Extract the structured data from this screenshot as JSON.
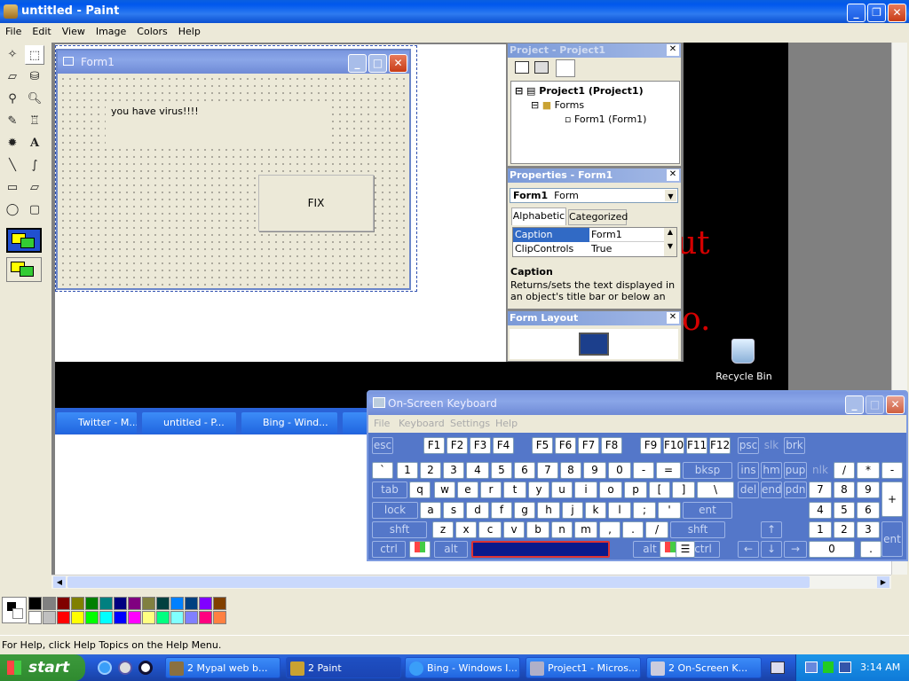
{
  "paint": {
    "title": "untitled - Paint",
    "menu": [
      "File",
      "Edit",
      "View",
      "Image",
      "Colors",
      "Help"
    ],
    "status": "For Help, click Help Topics on the Help Menu."
  },
  "form1": {
    "title": "Form1",
    "label": "you have virus!!!!",
    "button": "FIX"
  },
  "project": {
    "panel_title": "Project - Project1",
    "root": "Project1 (Project1)",
    "folder": "Forms",
    "form": "Form1 (Form1)"
  },
  "properties": {
    "panel_title": "Properties - Form1",
    "object_name": "Form1",
    "object_type": "Form",
    "tabs": [
      "Alphabetic",
      "Categorized"
    ],
    "rows": [
      {
        "name": "Caption",
        "value": "Form1"
      },
      {
        "name": "ClipControls",
        "value": "True"
      }
    ],
    "desc_title": "Caption",
    "desc_text": "Returns/sets the text displayed in an object's title bar or below an object's"
  },
  "form_layout": {
    "panel_title": "Form Layout"
  },
  "desktop": {
    "red_text_1": "ut",
    "red_text_2": "o.",
    "recycle_bin": "Recycle Bin"
  },
  "hidden_tasks": [
    "Twitter - M...",
    "untitled - P...",
    "Bing - Wind..."
  ],
  "osk": {
    "title": "On-Screen Keyboard",
    "menu": [
      "File",
      "Keyboard",
      "Settings",
      "Help"
    ],
    "row_fn": [
      "esc",
      "F1",
      "F2",
      "F3",
      "F4",
      "F5",
      "F6",
      "F7",
      "F8",
      "F9",
      "F10",
      "F11",
      "F12",
      "psc",
      "slk",
      "brk"
    ],
    "row_num": [
      "`",
      "1",
      "2",
      "3",
      "4",
      "5",
      "6",
      "7",
      "8",
      "9",
      "0",
      "-",
      "=",
      "bksp",
      "ins",
      "hm",
      "pup",
      "nlk",
      "/",
      "*",
      "-"
    ],
    "row_q": [
      "tab",
      "q",
      "w",
      "e",
      "r",
      "t",
      "y",
      "u",
      "i",
      "o",
      "p",
      "[",
      "]",
      "\\",
      "del",
      "end",
      "pdn",
      "7",
      "8",
      "9",
      "+"
    ],
    "row_a": [
      "lock",
      "a",
      "s",
      "d",
      "f",
      "g",
      "h",
      "j",
      "k",
      "l",
      ";",
      "'",
      "ent",
      "4",
      "5",
      "6"
    ],
    "row_z": [
      "shft",
      "z",
      "x",
      "c",
      "v",
      "b",
      "n",
      "m",
      ",",
      ".",
      "/",
      "shft",
      "↑",
      "1",
      "2",
      "3",
      "ent"
    ],
    "row_bottom": [
      "ctrl",
      "alt",
      "alt",
      "ctrl",
      "←",
      "↓",
      "→",
      "0",
      "."
    ]
  },
  "taskbar": {
    "start": "start",
    "items": [
      {
        "label": "2 Mypal web b...",
        "active": false
      },
      {
        "label": "2 Paint",
        "active": true
      },
      {
        "label": "Bing - Windows I...",
        "active": false
      },
      {
        "label": "Project1 - Micros...",
        "active": false
      },
      {
        "label": "2 On-Screen K...",
        "active": false
      }
    ],
    "clock": "3:14 AM"
  },
  "palette": [
    "#000000",
    "#808080",
    "#800000",
    "#808000",
    "#008000",
    "#008080",
    "#000080",
    "#800080",
    "#808040",
    "#004040",
    "#0080ff",
    "#004080",
    "#8000ff",
    "#804000",
    "#ffffff",
    "#c0c0c0",
    "#ff0000",
    "#ffff00",
    "#00ff00",
    "#00ffff",
    "#0000ff",
    "#ff00ff",
    "#ffff80",
    "#00ff80",
    "#80ffff",
    "#8080ff",
    "#ff0080",
    "#ff8040"
  ]
}
